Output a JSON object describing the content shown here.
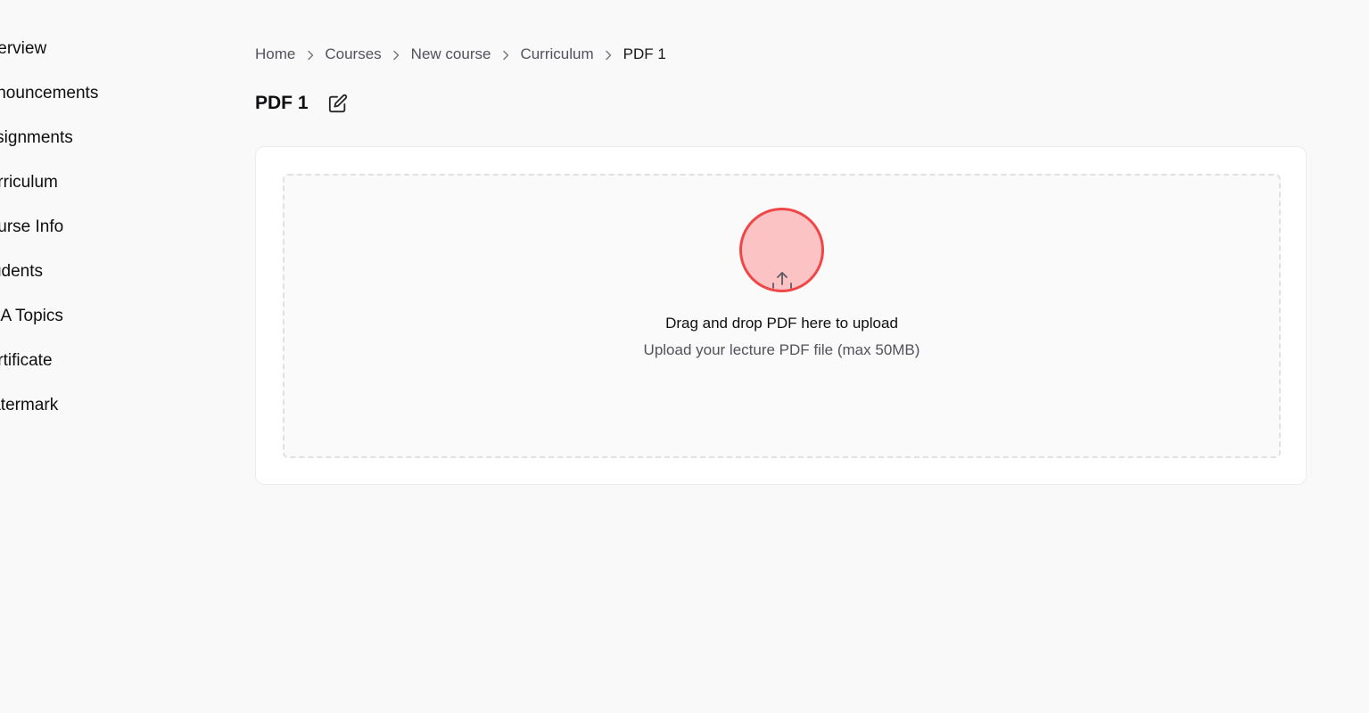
{
  "sidebar": {
    "items": [
      {
        "label": "Overview"
      },
      {
        "label": "Announcements"
      },
      {
        "label": "Assignments"
      },
      {
        "label": "Curriculum"
      },
      {
        "label": "Course Info"
      },
      {
        "label": "Students"
      },
      {
        "label": "Q&A Topics"
      },
      {
        "label": "Certificate"
      },
      {
        "label": "Watermark"
      }
    ]
  },
  "breadcrumb": {
    "items": [
      "Home",
      "Courses",
      "New course",
      "Curriculum",
      "PDF 1"
    ]
  },
  "page": {
    "title": "PDF 1",
    "edit_icon": "edit-icon"
  },
  "upload": {
    "icon": "upload-arrow-icon",
    "title": "Drag and drop PDF here to upload",
    "subtitle": "Upload your lecture PDF file (max 50MB)",
    "accent_color": "#ef4648",
    "accent_fill": "#fcc3c4"
  }
}
